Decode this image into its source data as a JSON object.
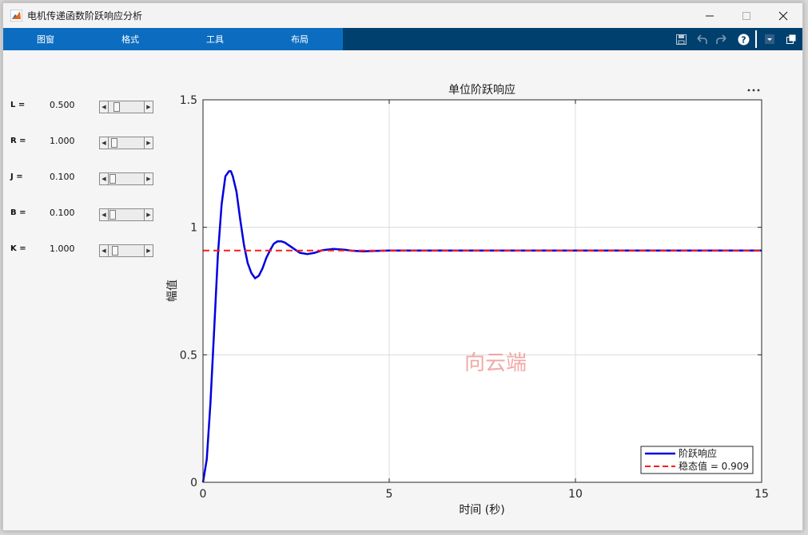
{
  "window": {
    "title": "电机传递函数阶跃响应分析",
    "minimize_icon": "minimize-icon",
    "maximize_icon": "maximize-icon",
    "close_icon": "close-icon"
  },
  "toolstrip": {
    "tabs": [
      {
        "label": "图窗"
      },
      {
        "label": "格式"
      },
      {
        "label": "工具"
      },
      {
        "label": "布局"
      }
    ],
    "icons": [
      "save-icon",
      "undo-icon",
      "redo-icon",
      "help-icon",
      "dropdown-icon",
      "undock-icon"
    ]
  },
  "params": [
    {
      "label": "L =",
      "value": "0.500",
      "slider_fraction": 0.17
    },
    {
      "label": "R =",
      "value": "1.000",
      "slider_fraction": 0.08
    },
    {
      "label": "J =",
      "value": "0.100",
      "slider_fraction": 0.02
    },
    {
      "label": "B =",
      "value": "0.100",
      "slider_fraction": 0.02
    },
    {
      "label": "K =",
      "value": "1.000",
      "slider_fraction": 0.11
    }
  ],
  "watermark": "向云端",
  "axes_menu_icon": "more-options-icon",
  "colors": {
    "step": "#0000e0",
    "steady": "#ff1a1a",
    "tab_bar": "#0c6dc0",
    "toolstrip": "#00406e"
  },
  "chart_data": {
    "type": "line",
    "title": "单位阶跃响应",
    "xlabel": "时间 (秒)",
    "ylabel": "幅值",
    "xlim": [
      0,
      15
    ],
    "ylim": [
      0,
      1.5
    ],
    "xticks": [
      0,
      5,
      10,
      15
    ],
    "yticks": [
      0,
      0.5,
      1,
      1.5
    ],
    "grid": true,
    "legend_position": "bottom-right",
    "series": [
      {
        "name": "阶跃响应",
        "style": "solid",
        "x": [
          0,
          0.1,
          0.2,
          0.3,
          0.4,
          0.5,
          0.6,
          0.7,
          0.75,
          0.8,
          0.9,
          1.0,
          1.1,
          1.2,
          1.3,
          1.4,
          1.5,
          1.6,
          1.7,
          1.8,
          1.9,
          2.0,
          2.1,
          2.2,
          2.4,
          2.6,
          2.8,
          3.0,
          3.2,
          3.5,
          3.8,
          4.0,
          4.3,
          4.5,
          5.0,
          6.0,
          8.0,
          10.0,
          12.0,
          15.0
        ],
        "y": [
          0,
          0.09,
          0.31,
          0.6,
          0.89,
          1.09,
          1.2,
          1.22,
          1.22,
          1.2,
          1.14,
          1.03,
          0.93,
          0.86,
          0.82,
          0.8,
          0.81,
          0.84,
          0.88,
          0.91,
          0.935,
          0.945,
          0.945,
          0.94,
          0.92,
          0.9,
          0.895,
          0.9,
          0.91,
          0.915,
          0.912,
          0.908,
          0.906,
          0.907,
          0.909,
          0.909,
          0.909,
          0.909,
          0.909,
          0.909
        ]
      },
      {
        "name": "稳态值 = 0.909",
        "style": "dashed",
        "x": [
          0,
          15
        ],
        "y": [
          0.909,
          0.909
        ]
      }
    ]
  }
}
